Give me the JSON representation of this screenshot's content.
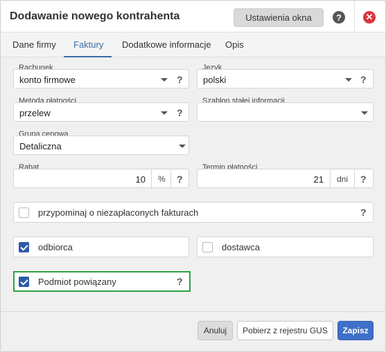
{
  "window": {
    "title": "Dodawanie nowego kontrahenta",
    "settings_label": "Ustawienia okna",
    "help_glyph": "?",
    "close_glyph": "✕"
  },
  "tabs": [
    {
      "label": "Dane firmy",
      "active": false
    },
    {
      "label": "Faktury",
      "active": true
    },
    {
      "label": "Dodatkowe informacje",
      "active": false
    },
    {
      "label": "Opis",
      "active": false
    }
  ],
  "form": {
    "rachunek": {
      "label": "Rachunek",
      "value": "konto firmowe"
    },
    "jezyk": {
      "label": "Język",
      "value": "polski"
    },
    "metoda": {
      "label": "Metoda płatności",
      "value": "przelew"
    },
    "szablon": {
      "label": "Szablon stałej informacji",
      "value": ""
    },
    "grupa": {
      "label": "Grupa cenowa",
      "value": "Detaliczna"
    },
    "rabat": {
      "label": "Rabat",
      "value": "10",
      "unit": "%"
    },
    "termin": {
      "label": "Termin płatności",
      "value": "21",
      "unit": "dni"
    },
    "help_glyph": "?"
  },
  "checkboxes": {
    "przypominaj": {
      "label": "przypominaj o niezapłaconych fakturach",
      "checked": false
    },
    "odbiorca": {
      "label": "odbiorca",
      "checked": true
    },
    "dostawca": {
      "label": "dostawca",
      "checked": false
    },
    "podmiot": {
      "label": "Podmiot powiązany",
      "checked": true
    }
  },
  "footer": {
    "cancel_label": "Anuluj",
    "gus_label": "Pobierz z rejestru GUS",
    "save_label": "Zapisz"
  },
  "colors": {
    "accent": "#3f6fc9",
    "close": "#d9363e",
    "highlight_border": "#2ea043"
  }
}
